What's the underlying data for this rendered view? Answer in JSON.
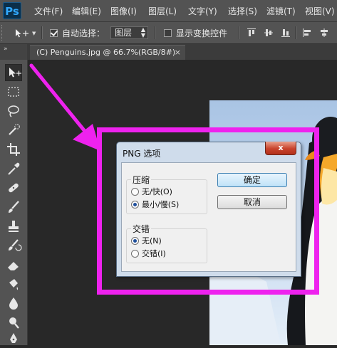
{
  "app": {
    "logo": "Ps"
  },
  "menu": [
    "文件(F)",
    "编辑(E)",
    "图像(I)",
    "图层(L)",
    "文字(Y)",
    "选择(S)",
    "滤镜(T)",
    "视图(V)"
  ],
  "options": {
    "auto_select_label": "自动选择：",
    "auto_select_checked": true,
    "layer_select_value": "图层",
    "show_transform_label": "显示变换控件",
    "show_transform_checked": false
  },
  "document_tab": {
    "title": "(C) Penguins.jpg @ 66.7%(RGB/8#)",
    "close": "×"
  },
  "tools": [
    "move-tool",
    "marquee-tool",
    "lasso-tool",
    "quick-select-tool",
    "crop-tool",
    "eyedropper-tool",
    "healing-brush-tool",
    "brush-tool",
    "clone-stamp-tool",
    "history-brush-tool",
    "eraser-tool",
    "gradient-tool",
    "blur-tool",
    "dodge-tool",
    "pen-tool"
  ],
  "highlight_color": "#ee22ee",
  "dialog": {
    "title": "PNG 选项",
    "close_symbol": "x",
    "compression": {
      "legend": "压缩",
      "options": [
        "无/快(O)",
        "最小/慢(S)"
      ],
      "selected": "最小/慢(S)"
    },
    "interlace": {
      "legend": "交错",
      "options": [
        "无(N)",
        "交错(I)"
      ],
      "selected": "无(N)"
    },
    "ok_label": "确定",
    "cancel_label": "取消"
  }
}
